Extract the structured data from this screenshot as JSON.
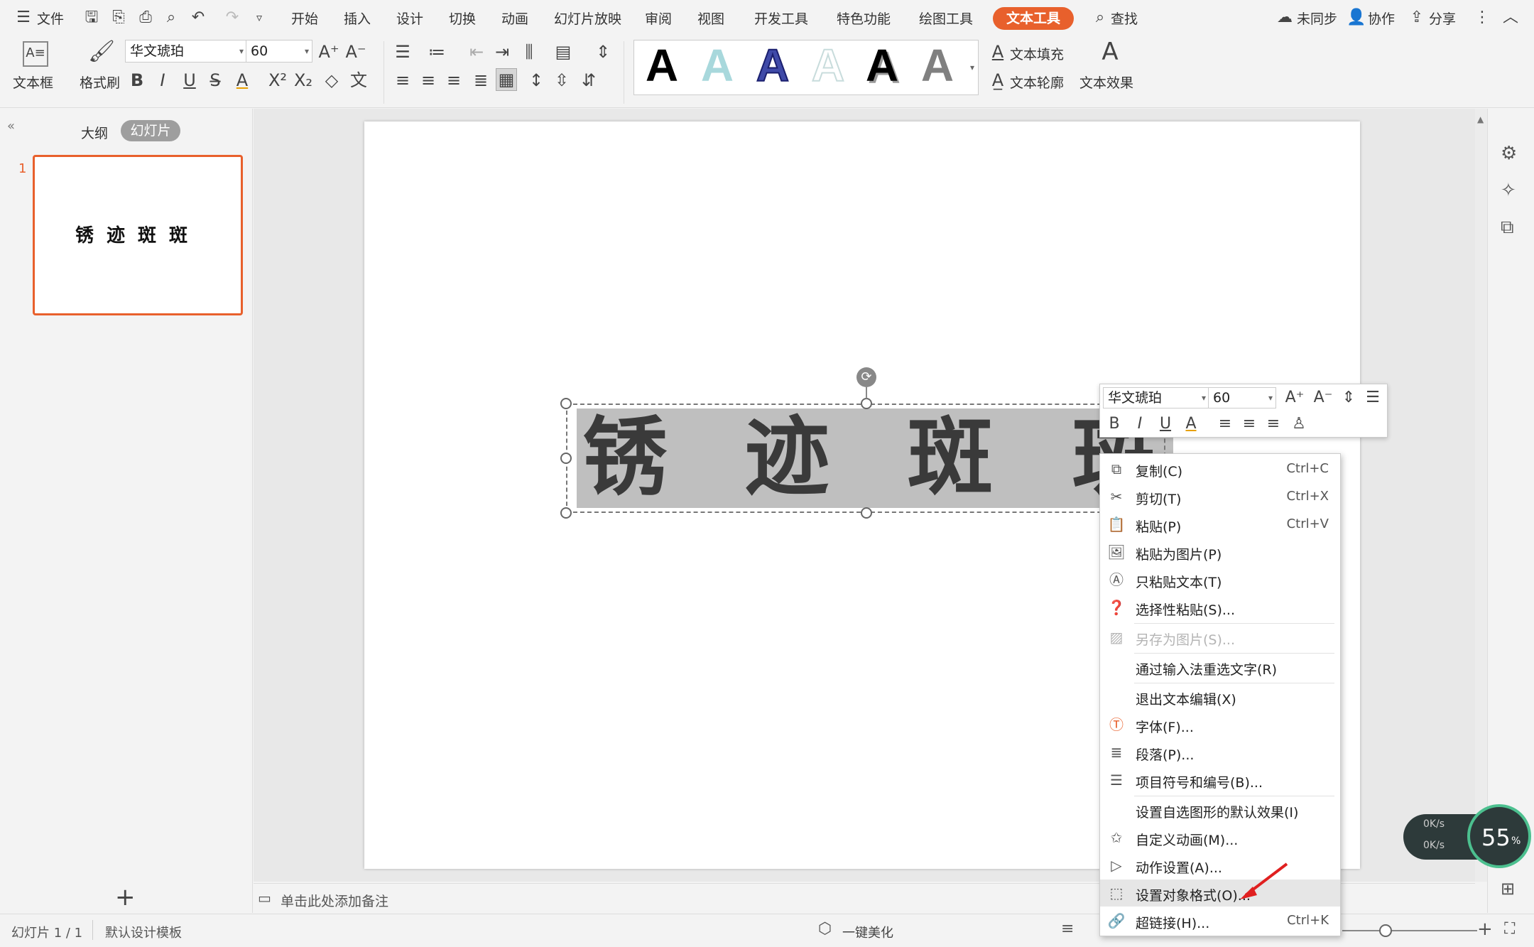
{
  "menubar": {
    "file": "文件",
    "tabs": [
      "开始",
      "插入",
      "设计",
      "切换",
      "动画",
      "幻灯片放映",
      "审阅",
      "视图",
      "开发工具",
      "特色功能",
      "绘图工具"
    ],
    "active_tab": "文本工具",
    "search": "查找",
    "sync": "未同步",
    "collab": "协作",
    "share": "分享"
  },
  "ribbon": {
    "textbox": "文本框",
    "format_painter": "格式刷",
    "font_name": "华文琥珀",
    "font_size": "60",
    "text_fill": "文本填充",
    "text_outline": "文本轮廓",
    "text_effect": "文本效果",
    "wordart_letter": "A"
  },
  "leftpanel": {
    "outline_tab": "大纲",
    "slides_tab": "幻灯片",
    "slide_number": "1",
    "thumb_text": "锈迹斑斑",
    "add": "+"
  },
  "slide": {
    "chars": [
      "锈",
      "迹",
      "斑",
      "斑"
    ]
  },
  "minitoolbar": {
    "font_name": "华文琥珀",
    "font_size": "60"
  },
  "context_menu": {
    "copy": "复制(C)",
    "copy_sc": "Ctrl+C",
    "cut": "剪切(T)",
    "cut_sc": "Ctrl+X",
    "paste": "粘贴(P)",
    "paste_sc": "Ctrl+V",
    "paste_as_picture": "粘贴为图片(P)",
    "paste_text_only": "只粘贴文本(T)",
    "paste_special": "选择性粘贴(S)...",
    "save_as_picture": "另存为图片(S)...",
    "reselect_ime": "通过输入法重选文字(R)",
    "exit_edit": "退出文本编辑(X)",
    "font": "字体(F)...",
    "paragraph": "段落(P)...",
    "bullets": "项目符号和编号(B)...",
    "set_default": "设置自选图形的默认效果(I)",
    "custom_anim": "自定义动画(M)...",
    "action": "动作设置(A)...",
    "format_object": "设置对象格式(O)...",
    "hyperlink": "超链接(H)...",
    "hyperlink_sc": "Ctrl+K"
  },
  "notes": {
    "placeholder": "单击此处添加备注"
  },
  "statusbar": {
    "slide_count": "幻灯片 1 / 1",
    "template": "默认设计模板",
    "beautify": "一键美化"
  },
  "speed": {
    "percent": "55",
    "unit": "%",
    "up": "0K/s",
    "down": "0K/s"
  },
  "colors": {
    "accent": "#e8602c",
    "text_fill_gray": "#bfbfbf",
    "glyph": "#3a3a3a"
  }
}
